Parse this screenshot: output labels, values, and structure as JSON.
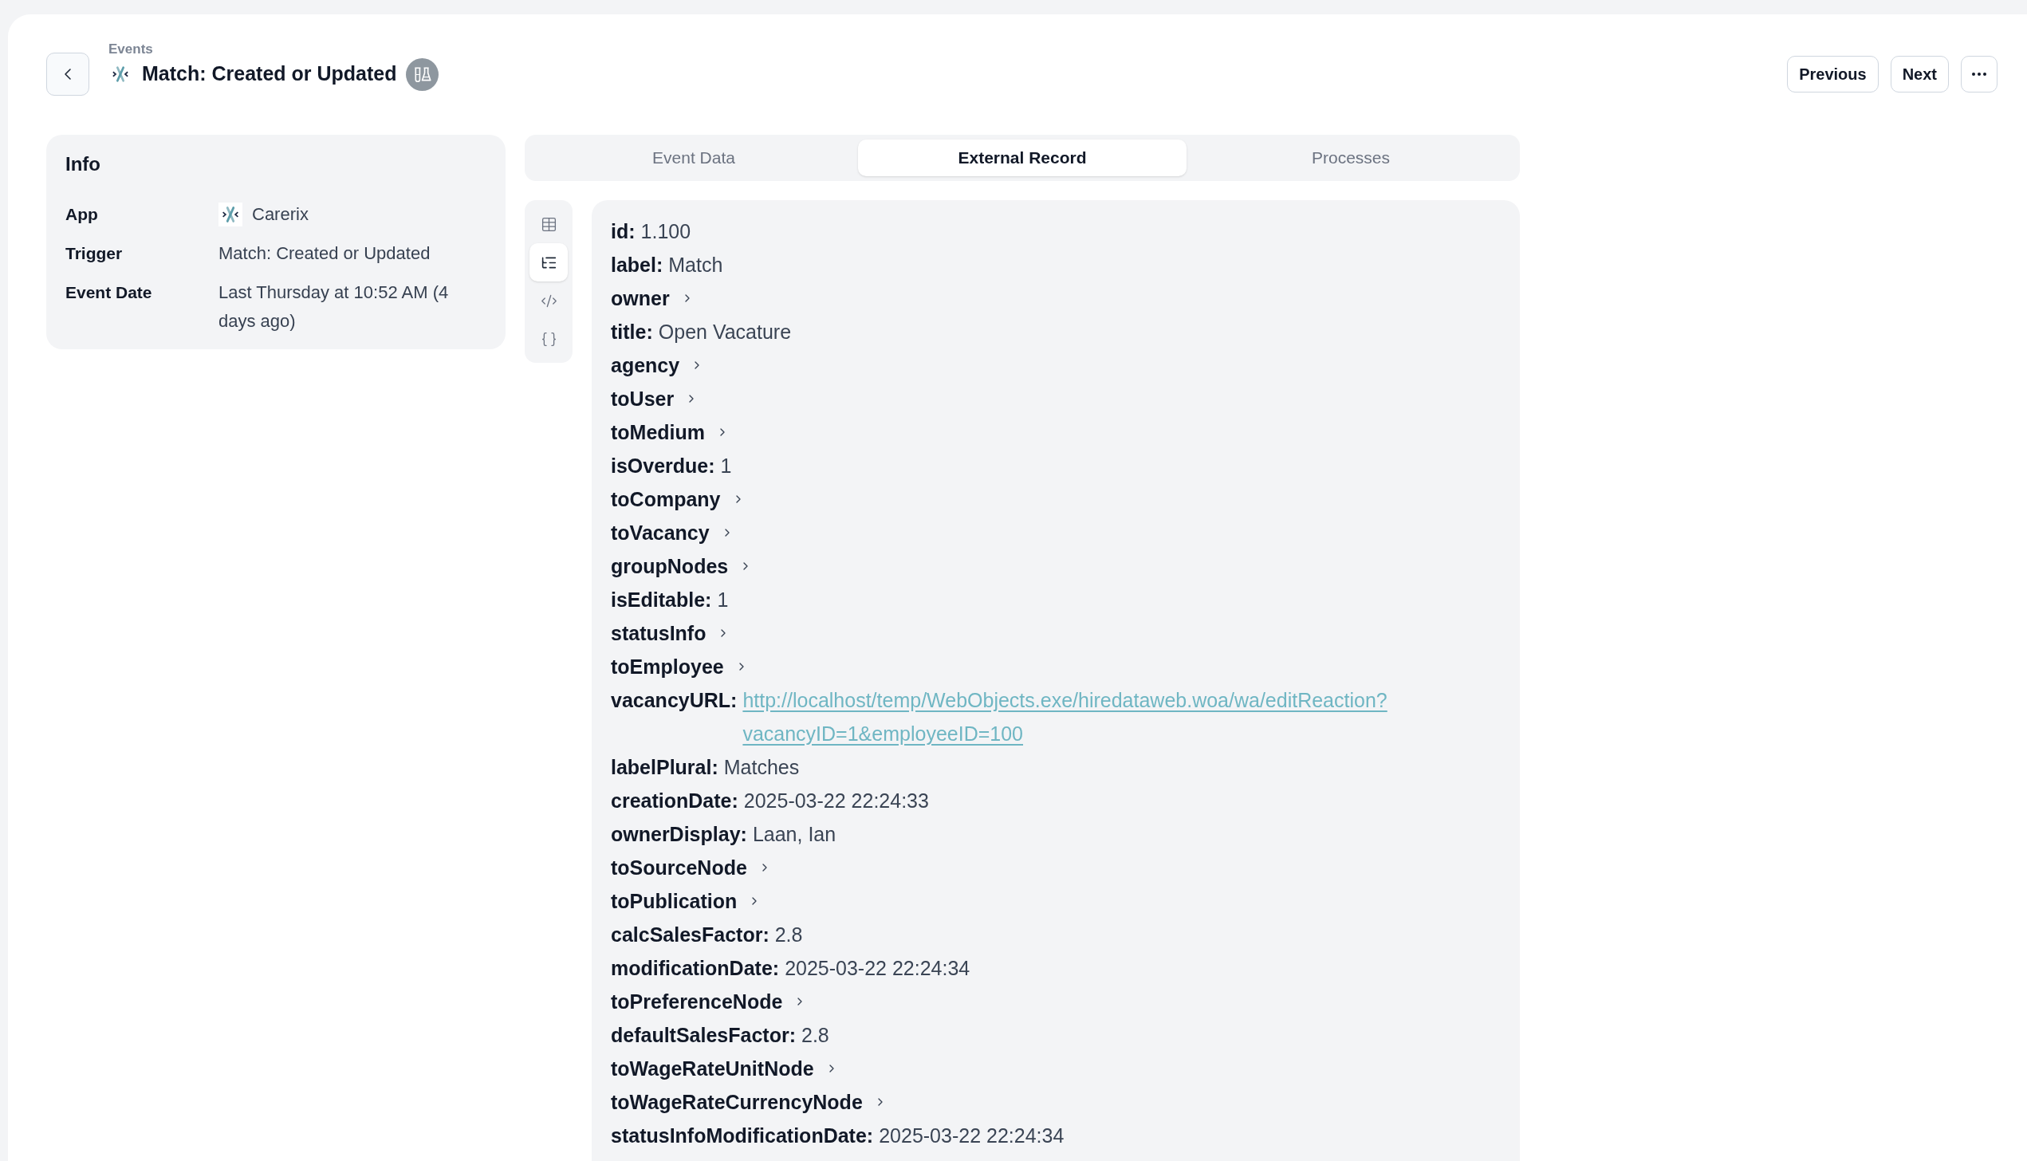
{
  "header": {
    "breadcrumb": "Events",
    "title": "Match: Created or Updated",
    "buttons": [
      "Previous",
      "Next"
    ]
  },
  "info": {
    "title": "Info",
    "rows": [
      {
        "kind": "app",
        "label": "App",
        "value": "Carerix"
      },
      {
        "kind": "text",
        "label": "Trigger",
        "value": "Match: Created or Updated"
      },
      {
        "kind": "text",
        "label": "Event Date",
        "value": "Last Thursday at 10:52 AM (4 days ago)"
      }
    ]
  },
  "tabs": [
    {
      "label": "Event Data",
      "selected": false
    },
    {
      "label": "External Record",
      "selected": true
    },
    {
      "label": "Processes",
      "selected": false
    }
  ],
  "view_modes": [
    {
      "kind": "table",
      "selected": false
    },
    {
      "kind": "tree",
      "selected": true
    },
    {
      "kind": "code",
      "selected": false
    },
    {
      "kind": "json",
      "selected": false
    }
  ],
  "record": {
    "fields": [
      {
        "kind": "value",
        "key": "id:",
        "value": "1.100"
      },
      {
        "kind": "value",
        "key": "label:",
        "value": "Match"
      },
      {
        "kind": "object",
        "key": "owner",
        "expanded": false
      },
      {
        "kind": "value",
        "key": "title:",
        "value": "Open Vacature"
      },
      {
        "kind": "object",
        "key": "agency",
        "expanded": false
      },
      {
        "kind": "object",
        "key": "toUser",
        "expanded": false
      },
      {
        "kind": "object",
        "key": "toMedium",
        "expanded": false
      },
      {
        "kind": "value",
        "key": "isOverdue:",
        "value": "1"
      },
      {
        "kind": "object",
        "key": "toCompany",
        "expanded": false
      },
      {
        "kind": "object",
        "key": "toVacancy",
        "expanded": false
      },
      {
        "kind": "object",
        "key": "groupNodes",
        "expanded": false
      },
      {
        "kind": "value",
        "key": "isEditable:",
        "value": "1"
      },
      {
        "kind": "object",
        "key": "statusInfo",
        "expanded": false
      },
      {
        "kind": "object",
        "key": "toEmployee",
        "expanded": false
      },
      {
        "kind": "link",
        "key": "vacancyURL:",
        "value": "http://localhost/temp/WebObjects.exe/hiredataweb.woa/wa/editReaction?vacancyID=1&employeeID=100"
      },
      {
        "kind": "value",
        "key": "labelPlural:",
        "value": "Matches"
      },
      {
        "kind": "value",
        "key": "creationDate:",
        "value": "2025-03-22 22:24:33"
      },
      {
        "kind": "value",
        "key": "ownerDisplay:",
        "value": "Laan, Ian"
      },
      {
        "kind": "object",
        "key": "toSourceNode",
        "expanded": false
      },
      {
        "kind": "object",
        "key": "toPublication",
        "expanded": false
      },
      {
        "kind": "value",
        "key": "calcSalesFactor:",
        "value": "2.8"
      },
      {
        "kind": "value",
        "key": "modificationDate:",
        "value": "2025-03-22 22:24:34"
      },
      {
        "kind": "object",
        "key": "toPreferenceNode",
        "expanded": false
      },
      {
        "kind": "value",
        "key": "defaultSalesFactor:",
        "value": "2.8"
      },
      {
        "kind": "object",
        "key": "toWageRateUnitNode",
        "expanded": false
      },
      {
        "kind": "object",
        "key": "toWageRateCurrencyNode",
        "expanded": false
      },
      {
        "kind": "value",
        "key": "statusInfoModificationDate:",
        "value": "2025-03-22 22:24:34"
      }
    ]
  }
}
